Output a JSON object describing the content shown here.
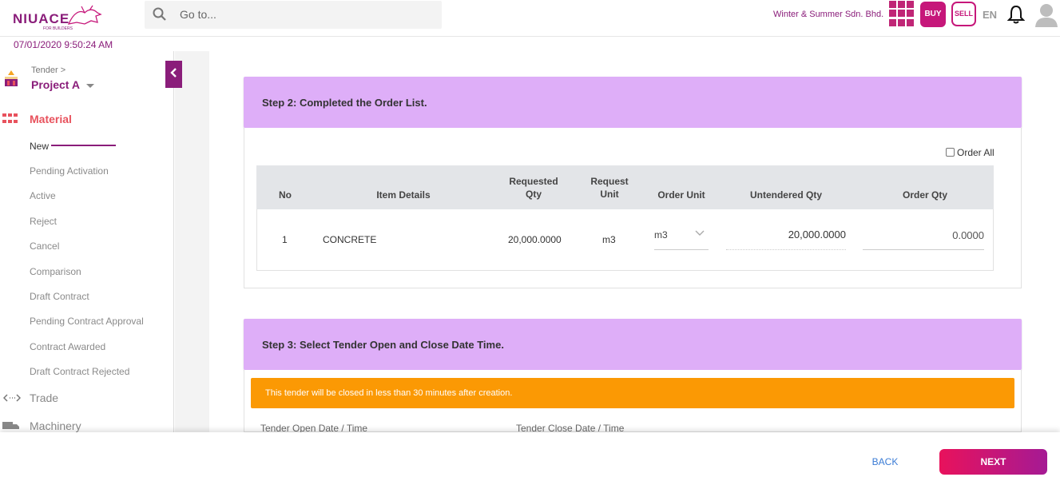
{
  "brand": {
    "logo_text": "NIUACE",
    "logo_sub": "FOR BUILDERS"
  },
  "search": {
    "placeholder": "Go to..."
  },
  "header": {
    "company": "Winter & Summer Sdn. Bhd.",
    "buy_label": "BUY",
    "sell_label": "SELL",
    "language": "EN"
  },
  "datetime": "07/01/2020 9:50:24 AM",
  "sidebar": {
    "breadcrumb": "Tender >",
    "project": "Project A",
    "section": "Material",
    "items": [
      {
        "label": "New"
      },
      {
        "label": "Pending Activation"
      },
      {
        "label": "Active"
      },
      {
        "label": "Reject"
      },
      {
        "label": "Cancel"
      },
      {
        "label": "Comparison"
      },
      {
        "label": "Draft Contract"
      },
      {
        "label": "Pending Contract Approval"
      },
      {
        "label": "Contract Awarded"
      },
      {
        "label": "Draft Contract Rejected"
      }
    ],
    "trade": "Trade",
    "machinery": "Machinery"
  },
  "step2": {
    "title": "Step 2: Completed the Order List.",
    "order_all": "Order All",
    "columns": {
      "no": "No",
      "item": "Item Details",
      "req_qty_1": "Requested",
      "req_qty_2": "Qty",
      "req_unit_1": "Request",
      "req_unit_2": "Unit",
      "order_unit": "Order Unit",
      "untendered": "Untendered Qty",
      "order_qty": "Order Qty"
    },
    "rows": [
      {
        "no": "1",
        "item": "CONCRETE",
        "requested_qty": "20,000.0000",
        "request_unit": "m3",
        "order_unit": "m3",
        "untendered_qty": "20,000.0000",
        "order_qty": "0.0000"
      }
    ]
  },
  "step3": {
    "title": "Step 3: Select Tender Open and Close Date Time.",
    "warning": "This tender will be closed in less than 30 minutes after creation.",
    "open_label": "Tender Open Date / Time",
    "close_label": "Tender Close Date / Time"
  },
  "footer": {
    "back": "BACK",
    "next": "NEXT"
  },
  "colors": {
    "brand": "#8a1d7a",
    "accent": "#c6177a",
    "step_header": "#deaef8",
    "warning": "#fb9904",
    "material": "#e8525d"
  }
}
